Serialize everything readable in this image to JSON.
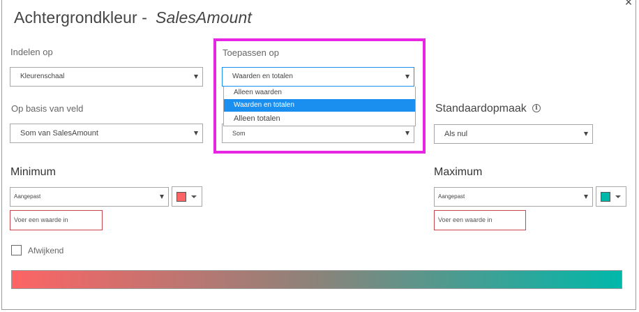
{
  "dialog": {
    "title": "Achtergrondkleur -",
    "field_name": "SalesAmount",
    "close_glyph": "×"
  },
  "format_by": {
    "label": "Indelen op",
    "value": "Kleurenschaal"
  },
  "apply_to": {
    "label": "Toepassen op",
    "value": "Waarden en totalen",
    "options": [
      "Alleen waarden",
      "Waarden en totalen",
      "Alleen totalen"
    ],
    "selected_index": 1
  },
  "based_on_field": {
    "label": "Op basis van veld",
    "value": "Som van SalesAmount"
  },
  "summarization": {
    "value": "Som"
  },
  "default_format": {
    "label": "Standaardopmaak",
    "info_glyph": "i",
    "value": "Als nul"
  },
  "minimum": {
    "label": "Minimum",
    "type_value": "Aangepast",
    "color": "#fd6465",
    "input_placeholder": "Voer een waarde in"
  },
  "maximum": {
    "label": "Maximum",
    "type_value": "Aangepast",
    "color": "#00b8aa",
    "input_placeholder": "Voer een waarde in"
  },
  "diverging": {
    "label": "Afwijkend",
    "checked": false
  },
  "gradient": {
    "start_color": "#fd6465",
    "mid_color": "#8b837a",
    "end_color": "#00b8aa"
  },
  "highlight_color": "#e726e3"
}
